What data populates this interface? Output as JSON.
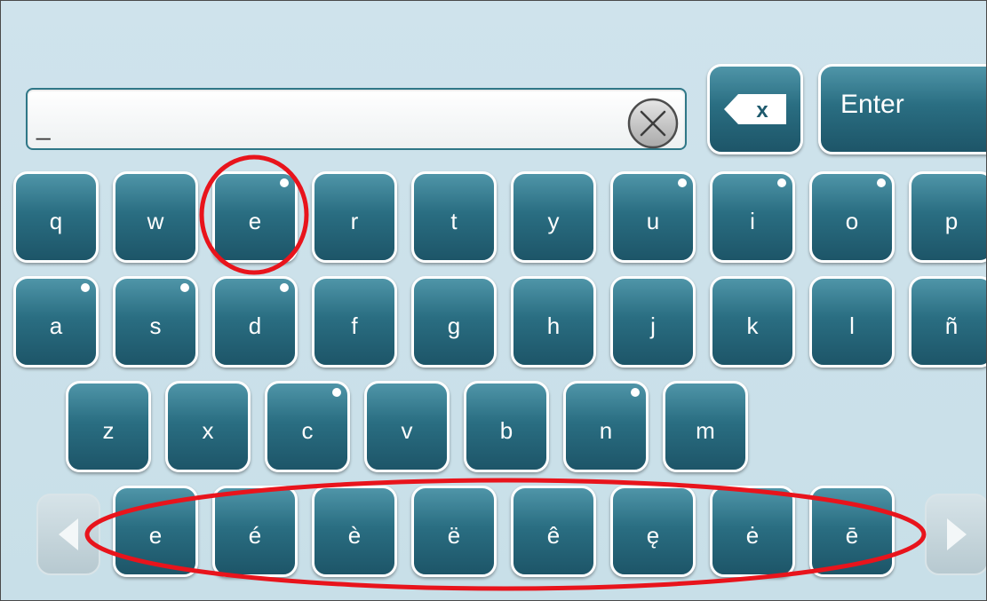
{
  "input": {
    "value": "_"
  },
  "keys": {
    "row1": [
      {
        "label": "q",
        "dot": false
      },
      {
        "label": "w",
        "dot": false
      },
      {
        "label": "e",
        "dot": true
      },
      {
        "label": "r",
        "dot": false
      },
      {
        "label": "t",
        "dot": false
      },
      {
        "label": "y",
        "dot": false
      },
      {
        "label": "u",
        "dot": true
      },
      {
        "label": "i",
        "dot": true
      },
      {
        "label": "o",
        "dot": true
      },
      {
        "label": "p",
        "dot": false
      }
    ],
    "row2": [
      {
        "label": "a",
        "dot": true
      },
      {
        "label": "s",
        "dot": true
      },
      {
        "label": "d",
        "dot": true
      },
      {
        "label": "f",
        "dot": false
      },
      {
        "label": "g",
        "dot": false
      },
      {
        "label": "h",
        "dot": false
      },
      {
        "label": "j",
        "dot": false
      },
      {
        "label": "k",
        "dot": false
      },
      {
        "label": "l",
        "dot": false
      },
      {
        "label": "ñ",
        "dot": false
      }
    ],
    "row3": [
      {
        "label": "z",
        "dot": false
      },
      {
        "label": "x",
        "dot": false
      },
      {
        "label": "c",
        "dot": true
      },
      {
        "label": "v",
        "dot": false
      },
      {
        "label": "b",
        "dot": false
      },
      {
        "label": "n",
        "dot": true
      },
      {
        "label": "m",
        "dot": false
      }
    ],
    "accents": [
      "e",
      "é",
      "è",
      "ë",
      "ê",
      "ę",
      "ė",
      "ē"
    ],
    "backspace_label": "x",
    "enter_label": "Enter"
  },
  "colors": {
    "key_top": "#4f95a8",
    "key_bottom": "#1d5568",
    "background": "#cfe3ec",
    "annotation": "#e8141c"
  },
  "icons": {
    "clear": "circle-x-icon",
    "backspace": "backspace-icon",
    "left": "left-arrow-icon",
    "right": "right-arrow-icon"
  }
}
